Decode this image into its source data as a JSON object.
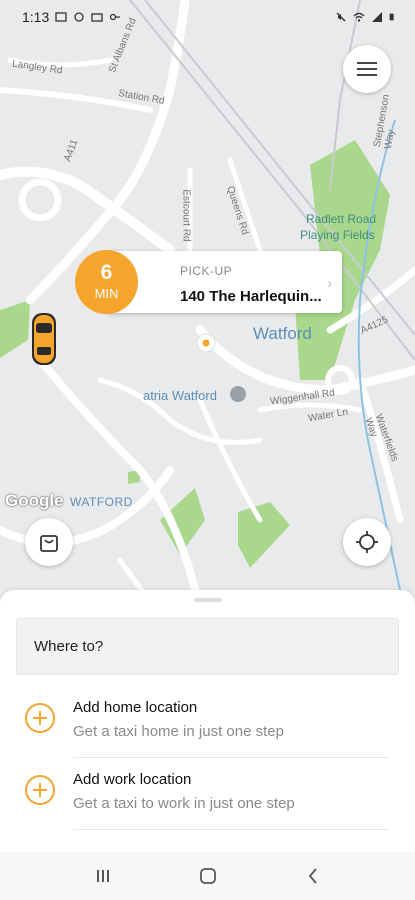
{
  "status_bar": {
    "time": "1:13"
  },
  "map": {
    "labels": {
      "langley": "Langley Rd",
      "station": "Station Rd",
      "radlett": "Radlett Road",
      "playing": "Playing Fields",
      "watford_big": "Watford",
      "atria": "atria Watford",
      "watford_small": "WATFORD",
      "queens": "Queens Rd",
      "estcourt": "Estcourt Rd",
      "st_albans": "St Albans Rd",
      "stephenson": "Stephenson Way",
      "wiggenhall": "Wiggenhall Rd",
      "water": "Water Ln",
      "waterfields": "Waterfields Way",
      "a4125": "A4125",
      "a411": "A411"
    },
    "google": "Google"
  },
  "pickup": {
    "eta_value": "6",
    "eta_unit": "MIN",
    "label": "PICK-UP",
    "address": "140 The Harlequin..."
  },
  "sheet": {
    "search_placeholder": "Where to?",
    "home": {
      "title": "Add home location",
      "subtitle": "Get a taxi home in just one step"
    },
    "work": {
      "title": "Add work location",
      "subtitle": "Get a taxi to work in just one step"
    }
  },
  "colors": {
    "accent": "#f5a52b",
    "park": "#a8d58a",
    "road": "#ffffff"
  },
  "icons": [
    "menu-icon",
    "shopping-bag-icon",
    "locate-icon",
    "car-icon",
    "pin-icon",
    "plus-icon"
  ]
}
